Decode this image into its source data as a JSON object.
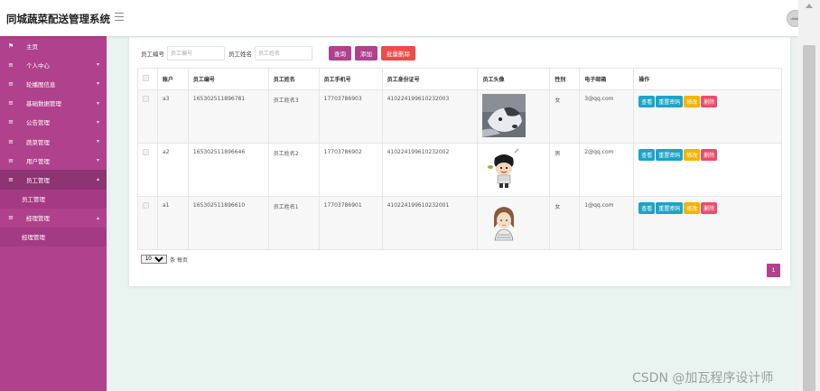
{
  "header": {
    "app_title": "同城蔬菜配送管理系统",
    "avatar_text": "dtddd"
  },
  "sidebar": {
    "items": [
      {
        "icon": "⚑",
        "label": "主页",
        "has_chevron": false
      },
      {
        "icon": "≡",
        "label": "个人中心",
        "has_chevron": true
      },
      {
        "icon": "≡",
        "label": "轮播图信息",
        "has_chevron": true
      },
      {
        "icon": "≡",
        "label": "基础数据管理",
        "has_chevron": true
      },
      {
        "icon": "≡",
        "label": "公告管理",
        "has_chevron": true
      },
      {
        "icon": "≡",
        "label": "蔬菜管理",
        "has_chevron": true
      },
      {
        "icon": "≡",
        "label": "用户管理",
        "has_chevron": true
      },
      {
        "icon": "≡",
        "label": "员工管理",
        "has_chevron": true,
        "active": true,
        "sub": "员工管理"
      },
      {
        "icon": "≡",
        "label": "经理管理",
        "has_chevron": true,
        "sub": "经理管理"
      }
    ]
  },
  "search": {
    "employee_no_label": "员工编号",
    "employee_no_placeholder": "员工编号",
    "employee_name_label": "员工姓名",
    "employee_name_placeholder": "员工姓名",
    "query_label": "查询",
    "add_label": "添加",
    "batch_delete_label": "批量删除"
  },
  "table": {
    "headers": [
      "账户",
      "员工编号",
      "员工姓名",
      "员工手机号",
      "员工身份证号",
      "员工头像",
      "性别",
      "电子邮箱",
      "操作"
    ],
    "actions": {
      "view": "查看",
      "reset": "重置密码",
      "edit": "修改",
      "delete": "删除"
    },
    "rows": [
      {
        "account": "a3",
        "emp_no": "165302511896781",
        "name": "员工姓名3",
        "phone": "17703786903",
        "id_card": "410224199610232003",
        "avatar": "husky-photo",
        "gender": "女",
        "email": "3@qq.com"
      },
      {
        "account": "a2",
        "emp_no": "165302511896646",
        "name": "员工姓名2",
        "phone": "17703786902",
        "id_card": "410224199610232002",
        "avatar": "cartoon-boy",
        "gender": "男",
        "email": "2@qq.com"
      },
      {
        "account": "a1",
        "emp_no": "165302511896610",
        "name": "员工姓名1",
        "phone": "17703786901",
        "id_card": "410224199610232001",
        "avatar": "cartoon-girl",
        "gender": "女",
        "email": "1@qq.com"
      }
    ]
  },
  "pager": {
    "page_size": "10",
    "per_page_label": "条 每页",
    "current_page": "1"
  },
  "watermark": "CSDN @加瓦程序设计师",
  "colors": {
    "brand": "#b0418d",
    "sidebar_active": "#8d3473",
    "info": "#1aa4c8",
    "warning": "#f4b400",
    "danger": "#ef4b4b"
  }
}
